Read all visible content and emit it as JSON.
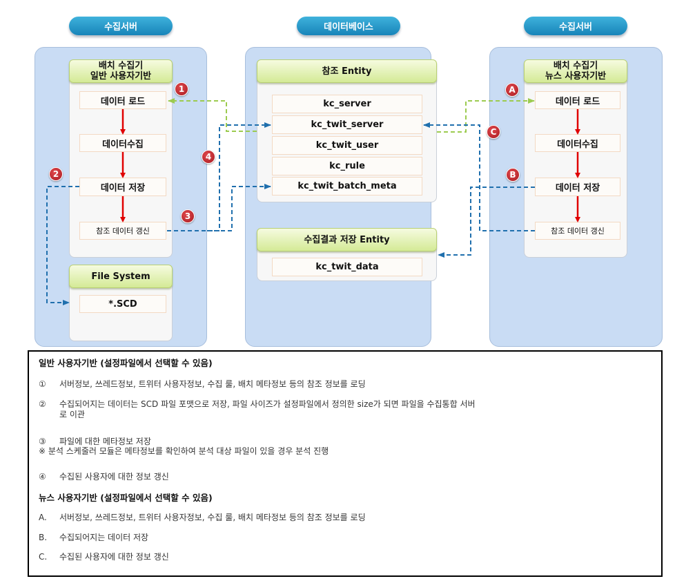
{
  "columns": {
    "left": {
      "pill": "수집서버",
      "collector_header": [
        "배치 수집기",
        "일반 사용자기반"
      ],
      "steps": [
        "데이터 로드",
        "데이터수집",
        "데이터 저장",
        "참조 데이터 갱신"
      ],
      "fs_header": "File System",
      "fs_items": [
        "*.SCD"
      ]
    },
    "middle": {
      "pill": "데이터베이스",
      "ref_header": "참조 Entity",
      "ref_rows": [
        "kc_server",
        "kc_twit_server",
        "kc_twit_user",
        "kc_rule",
        "kc_twit_batch_meta"
      ],
      "result_header": "수집결과 저장 Entity",
      "result_rows": [
        "kc_twit_data"
      ]
    },
    "right": {
      "pill": "수집서버",
      "collector_header": [
        "배치 수집기",
        "뉴스 사용자기반"
      ],
      "steps": [
        "데이터 로드",
        "데이터수집",
        "데이터 저장",
        "참조 데이터 갱신"
      ]
    }
  },
  "badges": {
    "b1": "1",
    "b2": "2",
    "b3": "3",
    "b4": "4",
    "bA": "A",
    "bB": "B",
    "bC": "C"
  },
  "colors": {
    "flow_arrow": "#e00000",
    "load_link": "#9ccb4f",
    "update_link": "#1f6fad",
    "badge": "#b8222a",
    "panel": "#c9dcf4"
  },
  "notes": {
    "general": {
      "heading": "일반 사용자기반 (설정파일에서 선택할 수 있음)",
      "items": [
        {
          "marker": "①",
          "text": "서버정보, 쓰레드정보, 트위터 사용자정보, 수집 룰, 배치 메타정보 등의 참조 정보를 로딩"
        },
        {
          "marker": "②",
          "text": "수집되어지는 데이터는 SCD 파일 포맷으로 저장, 파일 사이즈가 설정파일에서 정의한 size가 되면 파일을 수집통합 서버",
          "cont": "로 이관"
        },
        {
          "marker": "③",
          "text": "파일에 대한 메타정보 저장",
          "note": "※ 분석 스케줄러 모듈은 메타정보를 확인하여 분석 대상 파일이 있을 경우 분석 진행"
        },
        {
          "marker": "④",
          "text": "수집된 사용자에 대한 정보 갱신"
        }
      ]
    },
    "news": {
      "heading": "뉴스 사용자기반 (설정파일에서 선택할 수 있음)",
      "items": [
        {
          "marker": "A.",
          "text": "서버정보, 쓰레드정보, 트위터 사용자정보, 수집 룰, 배치 메타정보 등의 참조 정보를 로딩"
        },
        {
          "marker": "B.",
          "text": "수집되어지는 데이터 저장"
        },
        {
          "marker": "C.",
          "text": "수집된 사용자에 대한 정보 갱신"
        }
      ]
    }
  }
}
